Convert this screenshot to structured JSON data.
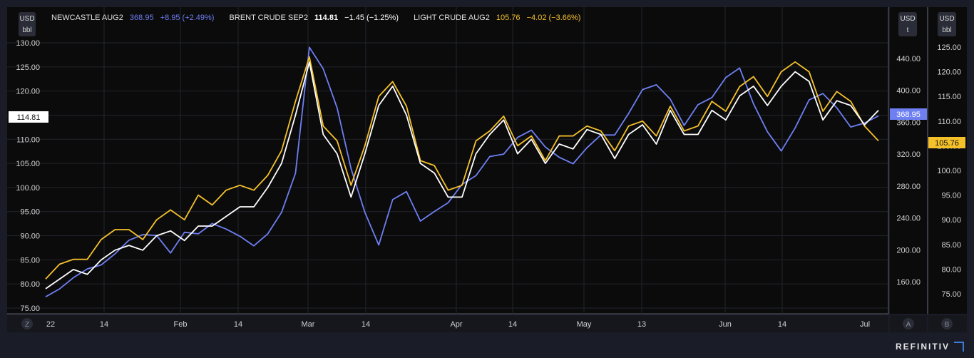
{
  "header": {
    "items": [
      {
        "name": "NEWCASTLE AUG2",
        "price": "368.95",
        "change": "+8.95 (+2.49%)",
        "color": "#6e7ff2"
      },
      {
        "name": "BRENT CRUDE SEP2",
        "price": "114.81",
        "change": "−1.45 (−1.25%)",
        "color": "#ffffff"
      },
      {
        "name": "LIGHT CRUDE AUG2",
        "price": "105.76",
        "change": "−4.02 (−3.66%)",
        "color": "#f5c12a"
      }
    ]
  },
  "axes": {
    "left_unit": [
      "USD",
      "bbl"
    ],
    "middle_unit": [
      "USD",
      "t"
    ],
    "right_unit": [
      "USD",
      "bbl"
    ],
    "left_ticks": [
      "130.00",
      "125.00",
      "120.00",
      "115.00",
      "110.00",
      "105.00",
      "100.00",
      "95.00",
      "90.00",
      "85.00",
      "80.00",
      "75.00"
    ],
    "middle_ticks": [
      "440.00",
      "400.00",
      "360.00",
      "320.00",
      "280.00",
      "240.00",
      "200.00",
      "160.00"
    ],
    "right_ticks": [
      "125.00",
      "120.00",
      "115.00",
      "110.00",
      "105.00",
      "100.00",
      "95.00",
      "90.00",
      "85.00",
      "80.00",
      "75.00"
    ],
    "x_ticks": [
      "22",
      "14",
      "Feb",
      "14",
      "Mar",
      "14",
      "Apr",
      "14",
      "May",
      "13",
      "Jun",
      "14",
      "Jul"
    ],
    "corner_labels": [
      "Z",
      "A",
      "B"
    ]
  },
  "badges": {
    "brent_last": "114.81",
    "newcastle_last": "368.95",
    "light_last": "105.76"
  },
  "brand": "REFINITIV",
  "chart_data": {
    "type": "line",
    "x_range": [
      "Dec 31, 2021",
      "Jul 2022"
    ],
    "series": [
      {
        "name": "BRENT CRUDE SEP2",
        "axis": "left",
        "color": "#ffffff",
        "x": [
          0,
          3,
          6,
          9,
          12,
          15,
          18,
          21,
          24,
          27,
          30,
          33,
          36,
          39,
          42,
          45,
          48,
          51,
          54,
          57,
          60,
          63,
          66,
          69,
          72,
          75,
          78,
          81,
          84,
          87,
          90,
          93,
          96,
          99,
          102,
          105,
          108,
          111,
          114,
          117,
          120,
          123,
          126,
          129,
          132,
          135,
          138,
          141,
          144,
          147,
          150,
          153,
          156,
          159,
          162,
          165,
          168,
          171,
          174,
          177,
          180
        ],
        "values": [
          79,
          81,
          83,
          82,
          85,
          87,
          88,
          87,
          90,
          91,
          89,
          92,
          92,
          94,
          96,
          96,
          100,
          105,
          115,
          126,
          111,
          107,
          98,
          107,
          117,
          121,
          115,
          105,
          103,
          98,
          98,
          107,
          111,
          114,
          107,
          110,
          105,
          109,
          108,
          112,
          111,
          106,
          111,
          113,
          109,
          116,
          111,
          111,
          116,
          114,
          119,
          121,
          117,
          121,
          124,
          122,
          114,
          118,
          117,
          113,
          116
        ],
        "ylim": [
          74,
          131
        ]
      },
      {
        "name": "LIGHT CRUDE AUG2",
        "axis": "right",
        "color": "#f5c12a",
        "x": [
          0,
          3,
          6,
          9,
          12,
          15,
          18,
          21,
          24,
          27,
          30,
          33,
          36,
          39,
          42,
          45,
          48,
          51,
          54,
          57,
          60,
          63,
          66,
          69,
          72,
          75,
          78,
          81,
          84,
          87,
          90,
          93,
          96,
          99,
          102,
          105,
          108,
          111,
          114,
          117,
          120,
          123,
          126,
          129,
          132,
          135,
          138,
          141,
          144,
          147,
          150,
          153,
          156,
          159,
          162,
          165,
          168,
          171,
          174,
          177,
          180
        ],
        "values": [
          78,
          81,
          82,
          82,
          86,
          88,
          88,
          86,
          90,
          92,
          90,
          95,
          93,
          96,
          97,
          96,
          99,
          104,
          114,
          123,
          109,
          106,
          97,
          105,
          115,
          118,
          113,
          102,
          101,
          96,
          97,
          106,
          108,
          111,
          105,
          107,
          102,
          107,
          107,
          109,
          108,
          104,
          109,
          110,
          107,
          113,
          108,
          109,
          114,
          112,
          117,
          119,
          115,
          120,
          122,
          120,
          112,
          116,
          114,
          109,
          106
        ],
        "ylim": [
          72,
          126
        ]
      },
      {
        "name": "NEWCASTLE AUG2",
        "axis": "middle",
        "color": "#6e7ff2",
        "x": [
          0,
          3,
          6,
          9,
          12,
          15,
          18,
          21,
          24,
          27,
          30,
          33,
          36,
          39,
          42,
          45,
          48,
          51,
          54,
          57,
          60,
          63,
          66,
          69,
          72,
          75,
          78,
          81,
          84,
          87,
          90,
          93,
          96,
          99,
          102,
          105,
          108,
          111,
          114,
          117,
          120,
          123,
          126,
          129,
          132,
          135,
          138,
          141,
          144,
          147,
          150,
          153,
          156,
          159,
          162,
          165,
          168,
          171,
          174,
          177,
          180
        ],
        "values": [
          141,
          151,
          165,
          176,
          181,
          195,
          212,
          219,
          218,
          196,
          222,
          220,
          233,
          226,
          217,
          205,
          220,
          247,
          296,
          454,
          427,
          378,
          302,
          247,
          206,
          263,
          273,
          236,
          248,
          259,
          282,
          293,
          317,
          320,
          341,
          350,
          329,
          316,
          308,
          328,
          344,
          344,
          371,
          401,
          407,
          389,
          356,
          382,
          391,
          416,
          428,
          383,
          348,
          324,
          353,
          388,
          396,
          378,
          354,
          359,
          368
        ],
        "ylim": [
          120,
          460
        ]
      }
    ]
  }
}
